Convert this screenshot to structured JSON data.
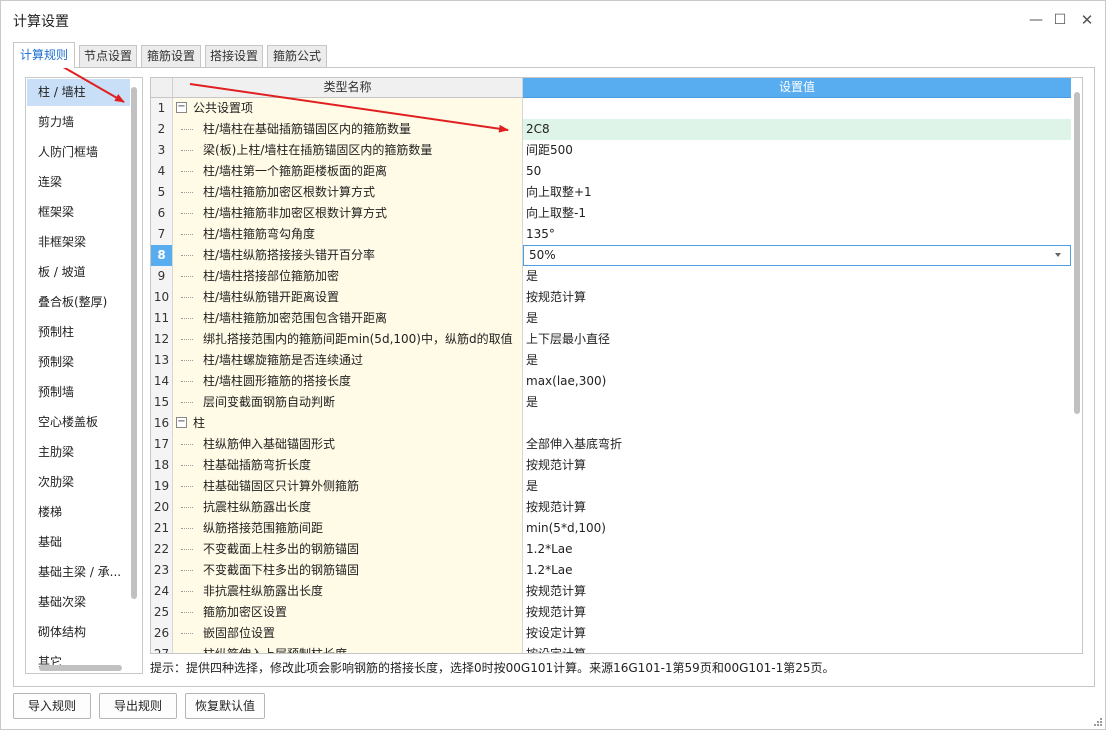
{
  "window": {
    "title": "计算设置",
    "controls": {
      "minimize": "—",
      "maximize": "☐",
      "close": "✕"
    }
  },
  "tabs": [
    {
      "label": "计算规则",
      "active": true
    },
    {
      "label": "节点设置",
      "active": false
    },
    {
      "label": "箍筋设置",
      "active": false
    },
    {
      "label": "搭接设置",
      "active": false
    },
    {
      "label": "箍筋公式",
      "active": false
    }
  ],
  "sidebar": {
    "items": [
      {
        "label": "柱 / 墙柱",
        "selected": true
      },
      {
        "label": "剪力墙"
      },
      {
        "label": "人防门框墙"
      },
      {
        "label": "连梁"
      },
      {
        "label": "框架梁"
      },
      {
        "label": "非框架梁"
      },
      {
        "label": "板 / 坡道"
      },
      {
        "label": "叠合板(整厚)"
      },
      {
        "label": "预制柱"
      },
      {
        "label": "预制梁"
      },
      {
        "label": "预制墙"
      },
      {
        "label": "空心楼盖板"
      },
      {
        "label": "主肋梁"
      },
      {
        "label": "次肋梁"
      },
      {
        "label": "楼梯"
      },
      {
        "label": "基础"
      },
      {
        "label": "基础主梁 / 承..."
      },
      {
        "label": "基础次梁"
      },
      {
        "label": "砌体结构"
      },
      {
        "label": "其它"
      }
    ]
  },
  "grid": {
    "columns": {
      "name": "类型名称",
      "value": "设置值"
    },
    "current_row": "8",
    "rows": [
      {
        "num": "1",
        "name": "公共设置项",
        "value": "",
        "group": true
      },
      {
        "num": "2",
        "name": "柱/墙柱在基础插筋锚固区内的箍筋数量",
        "value": "2C8",
        "highlight": true
      },
      {
        "num": "3",
        "name": "梁(板)上柱/墙柱在插筋锚固区内的箍筋数量",
        "value": "间距500"
      },
      {
        "num": "4",
        "name": "柱/墙柱第一个箍筋距楼板面的距离",
        "value": "50"
      },
      {
        "num": "5",
        "name": "柱/墙柱箍筋加密区根数计算方式",
        "value": "向上取整+1"
      },
      {
        "num": "6",
        "name": "柱/墙柱箍筋非加密区根数计算方式",
        "value": "向上取整-1"
      },
      {
        "num": "7",
        "name": "柱/墙柱箍筋弯勾角度",
        "value": "135°"
      },
      {
        "num": "8",
        "name": "柱/墙柱纵筋搭接接头错开百分率",
        "value": "50%",
        "editing": true
      },
      {
        "num": "9",
        "name": "柱/墙柱搭接部位箍筋加密",
        "value": "是"
      },
      {
        "num": "10",
        "name": "柱/墙柱纵筋错开距离设置",
        "value": "按规范计算"
      },
      {
        "num": "11",
        "name": "柱/墙柱箍筋加密范围包含错开距离",
        "value": "是"
      },
      {
        "num": "12",
        "name": "绑扎搭接范围内的箍筋间距min(5d,100)中，纵筋d的取值",
        "value": "上下层最小直径"
      },
      {
        "num": "13",
        "name": "柱/墙柱螺旋箍筋是否连续通过",
        "value": "是"
      },
      {
        "num": "14",
        "name": "柱/墙柱圆形箍筋的搭接长度",
        "value": "max(lae,300)"
      },
      {
        "num": "15",
        "name": "层间变截面钢筋自动判断",
        "value": "是"
      },
      {
        "num": "16",
        "name": "柱",
        "value": "",
        "group": true
      },
      {
        "num": "17",
        "name": "柱纵筋伸入基础锚固形式",
        "value": "全部伸入基底弯折"
      },
      {
        "num": "18",
        "name": "柱基础插筋弯折长度",
        "value": "按规范计算"
      },
      {
        "num": "19",
        "name": "柱基础锚固区只计算外侧箍筋",
        "value": "是"
      },
      {
        "num": "20",
        "name": "抗震柱纵筋露出长度",
        "value": "按规范计算"
      },
      {
        "num": "21",
        "name": "纵筋搭接范围箍筋间距",
        "value": "min(5*d,100)"
      },
      {
        "num": "22",
        "name": "不变截面上柱多出的钢筋锚固",
        "value": "1.2*Lae"
      },
      {
        "num": "23",
        "name": "不变截面下柱多出的钢筋锚固",
        "value": "1.2*Lae"
      },
      {
        "num": "24",
        "name": "非抗震柱纵筋露出长度",
        "value": "按规范计算"
      },
      {
        "num": "25",
        "name": "箍筋加密区设置",
        "value": "按规范计算"
      },
      {
        "num": "26",
        "name": "嵌固部位设置",
        "value": "按设定计算"
      },
      {
        "num": "27",
        "name": "柱纵筋伸入上层预制柱长度",
        "value": "按设定计算"
      }
    ]
  },
  "hint": "提示：提供四种选择，修改此项会影响钢筋的搭接长度，选择0时按00G101计算。来源16G101-1第59页和00G101-1第25页。",
  "buttons": {
    "import": "导入规则",
    "export": "导出规则",
    "restore": "恢复默认值"
  },
  "colors": {
    "accent": "#58acf0",
    "selected_row_bg": "#def4e8",
    "name_col_bg": "#fffbe6",
    "annotation_arrow": "#e02020"
  }
}
